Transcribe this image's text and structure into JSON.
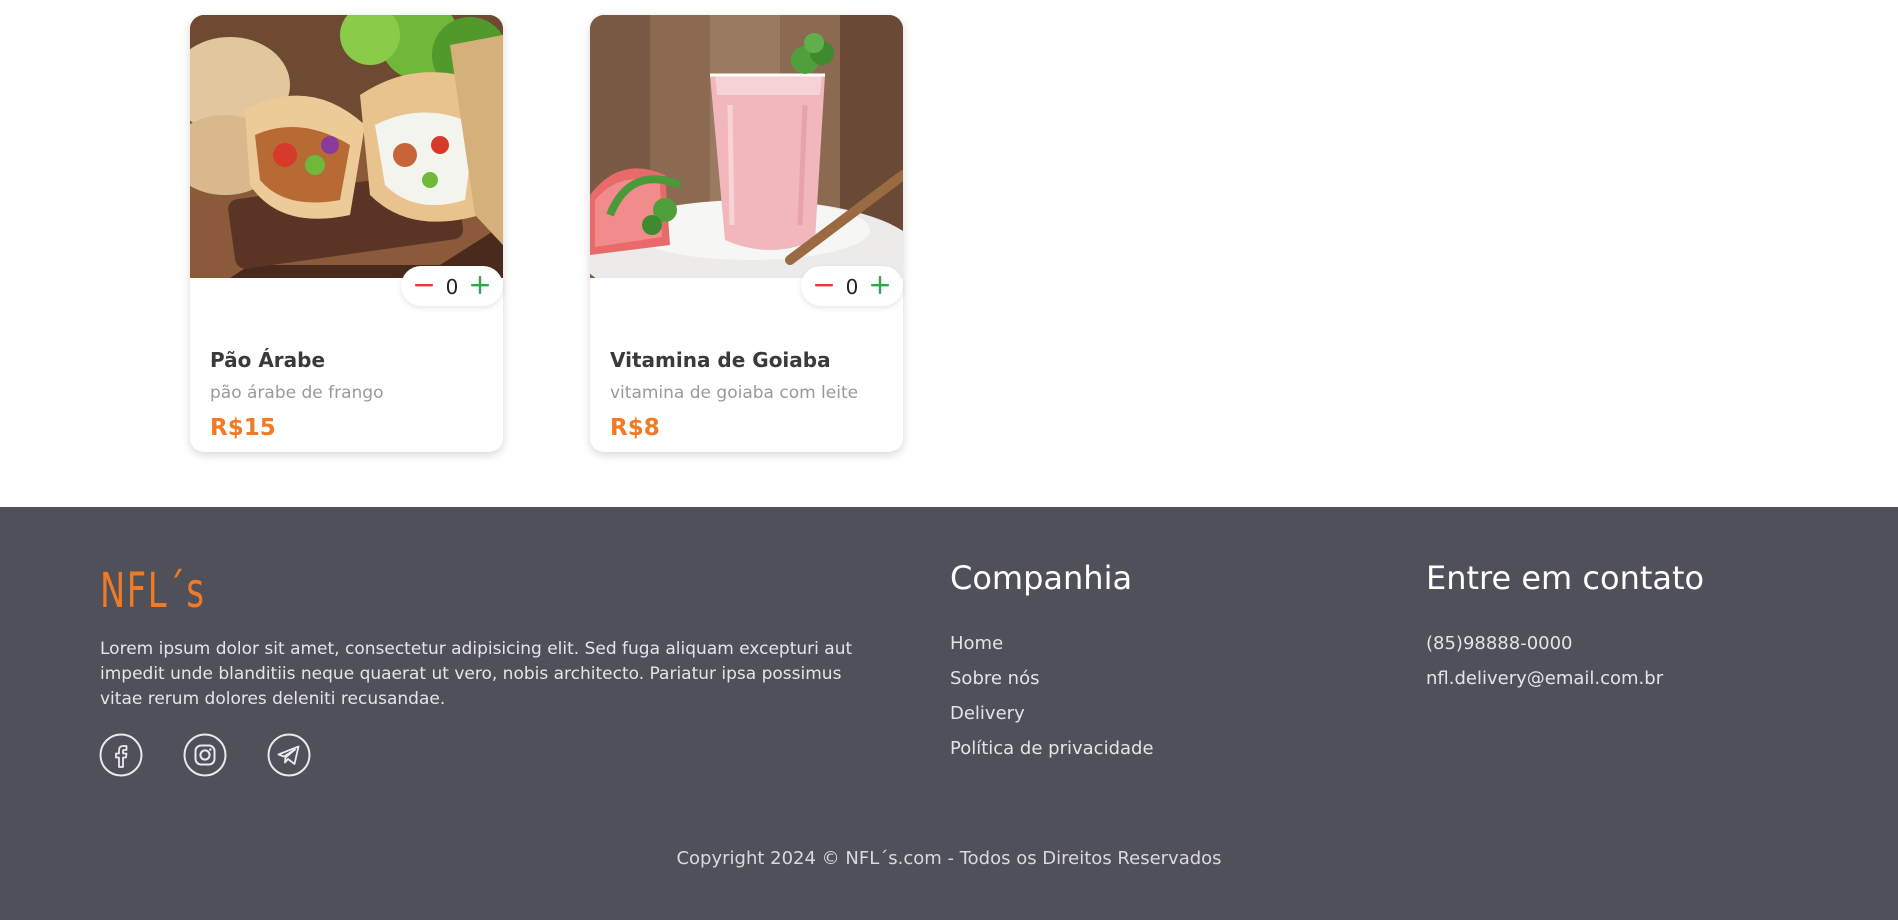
{
  "products": [
    {
      "name": "Pão Árabe",
      "description": "pão árabe de frango",
      "price": "R$15",
      "quantity": "0",
      "image_icon": "pita-sandwich-image"
    },
    {
      "name": "Vitamina de Goiaba",
      "description": "vitamina de goiaba com leite",
      "price": "R$8",
      "quantity": "0",
      "image_icon": "smoothie-glass-image"
    }
  ],
  "footer": {
    "logo": "NFL´s",
    "about": "Lorem ipsum dolor sit amet, consectetur adipisicing elit. Sed fuga aliquam excepturi aut impedit unde blanditiis neque quaerat ut vero, nobis architecto. Pariatur ipsa possimus vitae rerum dolores deleniti recusandae.",
    "social": [
      "facebook-icon",
      "instagram-icon",
      "telegram-icon"
    ],
    "company": {
      "title": "Companhia",
      "links": [
        "Home",
        "Sobre nós",
        "Delivery",
        "Política de privacidade"
      ]
    },
    "contact": {
      "title": "Entre em contato",
      "phone": "(85)98888-0000",
      "email": "nfl.delivery@email.com.br"
    },
    "copyright": "Copyright 2024 © NFL´s.com - Todos os Direitos Reservados"
  },
  "colors": {
    "accent": "#f07a26",
    "footer_bg": "#50505a",
    "minus": "#e03a3a",
    "plus": "#2aa84a"
  }
}
